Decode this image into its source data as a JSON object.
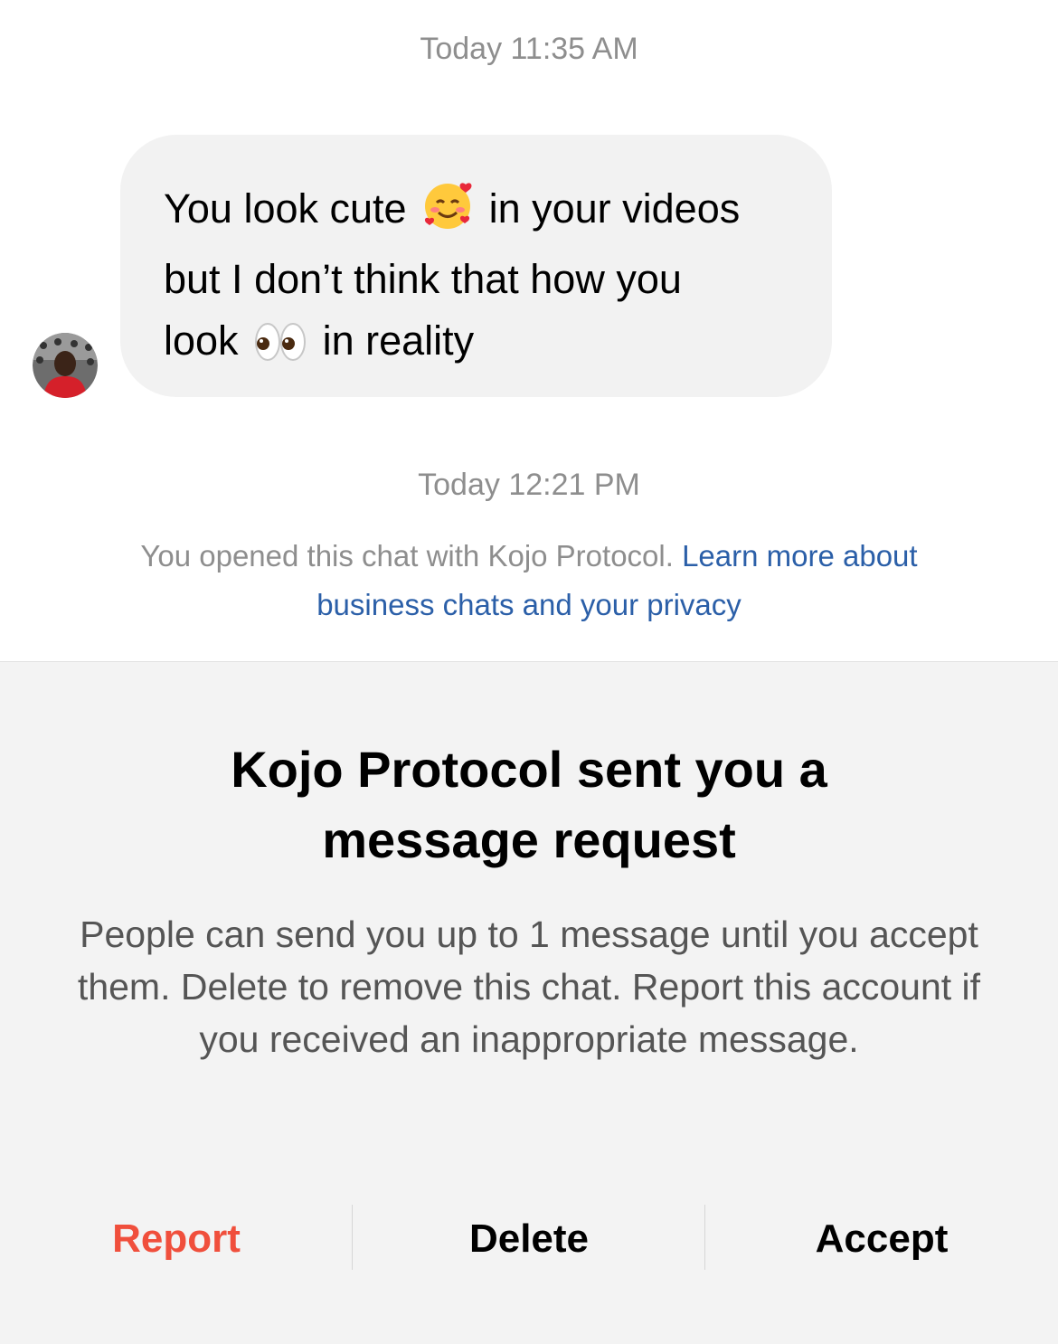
{
  "chat": {
    "timestamp_1": "Today 11:35 AM",
    "message": {
      "line1_a": "You look cute",
      "line1_emoji": "smiling-face-with-hearts-emoji",
      "line1_b": "in your videos",
      "line2": "but I don’t think that how you",
      "line3_a": "look",
      "line3_emoji": "eyes-emoji",
      "line3_b": "in reality"
    },
    "timestamp_2": "Today 12:21 PM",
    "notice_text": "You opened this chat with Kojo Protocol.",
    "notice_link": "Learn more about business chats and your privacy"
  },
  "request": {
    "title": "Kojo Protocol sent you a message request",
    "body": "People can send you up to 1 message until you accept them. Delete to remove this chat. Report this account if you received an inappropriate message.",
    "actions": {
      "report": "Report",
      "delete": "Delete",
      "accept": "Accept"
    }
  },
  "colors": {
    "report": "#f04f3c",
    "link": "#2b5fa8",
    "bubble": "#f2f2f2",
    "panel": "#f3f3f3"
  }
}
